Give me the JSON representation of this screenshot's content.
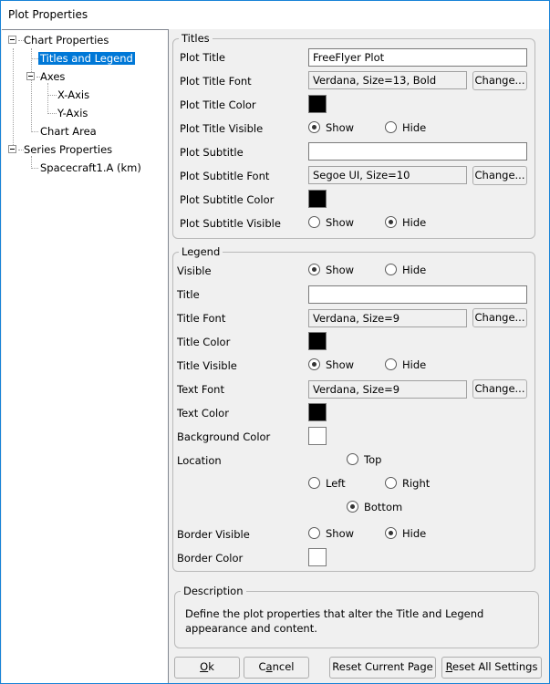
{
  "window": {
    "title": "Plot Properties"
  },
  "tree": {
    "nodes": [
      {
        "label": "Chart Properties",
        "level": 0,
        "expanded": true
      },
      {
        "label": "Titles and Legend",
        "level": 1,
        "selected": true
      },
      {
        "label": "Axes",
        "level": 1,
        "expanded": true
      },
      {
        "label": "X-Axis",
        "level": 2
      },
      {
        "label": "Y-Axis",
        "level": 2
      },
      {
        "label": "Chart Area",
        "level": 1
      },
      {
        "label": "Series Properties",
        "level": 0,
        "expanded": true
      },
      {
        "label": "Spacecraft1.A (km)",
        "level": 1
      }
    ]
  },
  "titles": {
    "group_label": "Titles",
    "plot_title": {
      "label": "Plot Title",
      "value": "FreeFlyer Plot"
    },
    "plot_title_font": {
      "label": "Plot Title Font",
      "value": "Verdana, Size=13, Bold",
      "button": "Change..."
    },
    "plot_title_color": {
      "label": "Plot Title Color",
      "color": "#000000"
    },
    "plot_title_visible": {
      "label": "Plot Title Visible",
      "show": "Show",
      "hide": "Hide",
      "selected": "Show"
    },
    "plot_subtitle": {
      "label": "Plot Subtitle",
      "value": ""
    },
    "plot_subtitle_font": {
      "label": "Plot Subtitle Font",
      "value": "Segoe UI, Size=10",
      "button": "Change..."
    },
    "plot_subtitle_color": {
      "label": "Plot Subtitle Color",
      "color": "#000000"
    },
    "plot_subtitle_visible": {
      "label": "Plot Subtitle Visible",
      "show": "Show",
      "hide": "Hide",
      "selected": "Hide"
    }
  },
  "legend": {
    "group_label": "Legend",
    "visible": {
      "label": "Visible",
      "show": "Show",
      "hide": "Hide",
      "selected": "Show"
    },
    "title": {
      "label": "Title",
      "value": ""
    },
    "title_font": {
      "label": "Title Font",
      "value": "Verdana, Size=9",
      "button": "Change..."
    },
    "title_color": {
      "label": "Title Color",
      "color": "#000000"
    },
    "title_visible": {
      "label": "Title Visible",
      "show": "Show",
      "hide": "Hide",
      "selected": "Show"
    },
    "text_font": {
      "label": "Text Font",
      "value": "Verdana, Size=9",
      "button": "Change..."
    },
    "text_color": {
      "label": "Text Color",
      "color": "#000000"
    },
    "background_color": {
      "label": "Background Color",
      "color": "#ffffff"
    },
    "location": {
      "label": "Location",
      "top": "Top",
      "left": "Left",
      "right": "Right",
      "bottom": "Bottom",
      "selected": "Bottom"
    },
    "border_visible": {
      "label": "Border Visible",
      "show": "Show",
      "hide": "Hide",
      "selected": "Hide"
    },
    "border_color": {
      "label": "Border Color",
      "color": "#ffffff"
    }
  },
  "description": {
    "group_label": "Description",
    "text": "Define the plot properties that alter the Title and Legend appearance and content."
  },
  "buttons": {
    "ok": {
      "mnemonic": "O",
      "rest": "k"
    },
    "cancel": {
      "pre": "C",
      "mnemonic": "a",
      "rest": "ncel"
    },
    "reset_current": "Reset Current Page",
    "reset_all": {
      "mnemonic": "R",
      "rest": "eset All Settings"
    }
  }
}
